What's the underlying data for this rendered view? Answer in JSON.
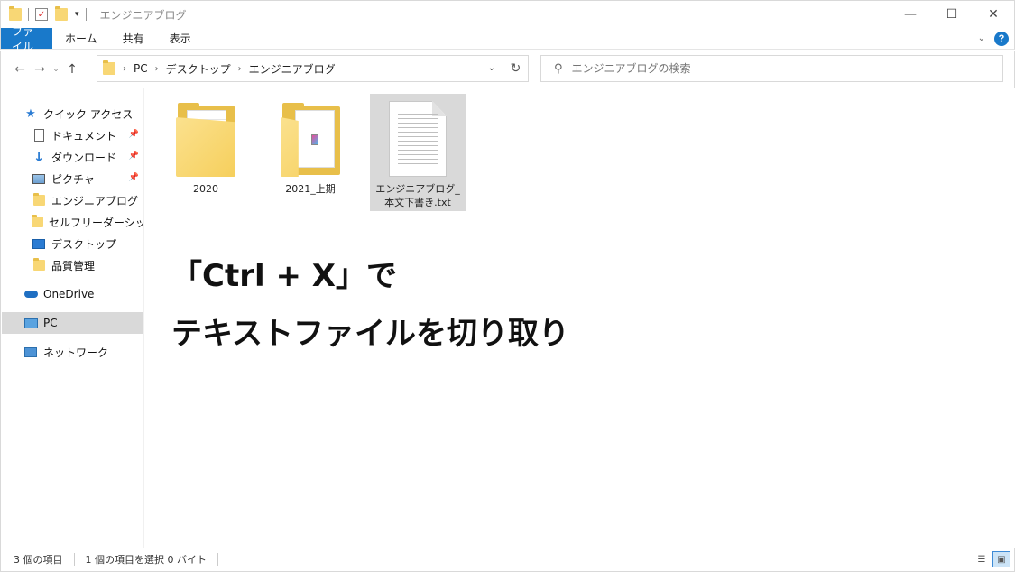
{
  "window": {
    "title": "エンジニアブログ",
    "controls": {
      "minimize": "—",
      "maximize": "☐",
      "close": "✕"
    }
  },
  "ribbon": {
    "tabs": [
      {
        "label": "ファイル",
        "active": true
      },
      {
        "label": "ホーム"
      },
      {
        "label": "共有"
      },
      {
        "label": "表示"
      }
    ],
    "help": "?"
  },
  "address": {
    "crumbs": [
      "PC",
      "デスクトップ",
      "エンジニアブログ"
    ]
  },
  "search": {
    "placeholder": "エンジニアブログの検索"
  },
  "sidebar": {
    "items": [
      {
        "label": "クイック アクセス",
        "icon": "star-icon"
      },
      {
        "label": "ドキュメント",
        "icon": "document-icon",
        "pinned": true
      },
      {
        "label": "ダウンロード",
        "icon": "download-icon",
        "pinned": true
      },
      {
        "label": "ピクチャ",
        "icon": "picture-icon",
        "pinned": true
      },
      {
        "label": "エンジニアブログ",
        "icon": "folder-icon"
      },
      {
        "label": "セルフリーダーシップ研修",
        "icon": "folder-icon"
      },
      {
        "label": "デスクトップ",
        "icon": "desktop-icon"
      },
      {
        "label": "品質管理",
        "icon": "folder-icon"
      },
      {
        "label": "OneDrive",
        "icon": "cloud-icon"
      },
      {
        "label": "PC",
        "icon": "computer-icon",
        "selected": true
      },
      {
        "label": "ネットワーク",
        "icon": "network-icon"
      }
    ]
  },
  "files": [
    {
      "name": "2020",
      "type": "folder"
    },
    {
      "name": "2021_上期",
      "type": "folder"
    },
    {
      "name": "エンジニアブログ_本文下書き.txt",
      "type": "text",
      "selected": true
    }
  ],
  "overlay": {
    "line1": "「Ctrl + X」で",
    "line2": "テキストファイルを切り取り"
  },
  "status": {
    "item_count": "3 個の項目",
    "selection": "1 個の項目を選択 0 バイト"
  },
  "colors": {
    "accent": "#1979ca",
    "folder": "#f8d775",
    "selected": "#d9d9d9"
  }
}
